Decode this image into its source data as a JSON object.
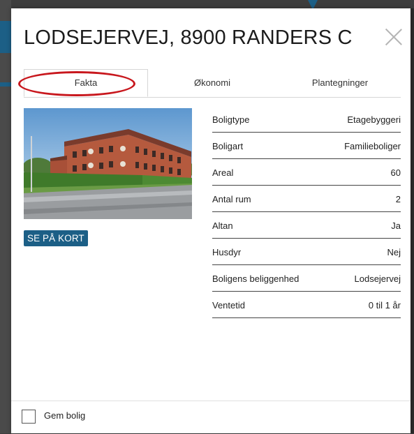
{
  "modal": {
    "title": "LODSEJERVEJ, 8900 RANDERS C"
  },
  "tabs": [
    {
      "label": "Fakta",
      "active": true
    },
    {
      "label": "Økonomi",
      "active": false
    },
    {
      "label": "Plantegninger",
      "active": false
    }
  ],
  "actions": {
    "map_button": "SE PÅ KORT"
  },
  "facts": [
    {
      "label": "Boligtype",
      "value": "Etagebyggeri"
    },
    {
      "label": "Boligart",
      "value": "Familieboliger"
    },
    {
      "label": "Areal",
      "value": "60"
    },
    {
      "label": "Antal rum",
      "value": "2"
    },
    {
      "label": "Altan",
      "value": "Ja"
    },
    {
      "label": "Husdyr",
      "value": "Nej"
    },
    {
      "label": "Boligens beliggenhed",
      "value": "Lodsejervej"
    },
    {
      "label": "Ventetid",
      "value": "0 til 1 år"
    }
  ],
  "footer": {
    "save_label": "Gem bolig",
    "checked": false
  },
  "colors": {
    "accent": "#1c5f86",
    "annotation": "#c8171d",
    "backdrop": "#3d3d3d"
  }
}
